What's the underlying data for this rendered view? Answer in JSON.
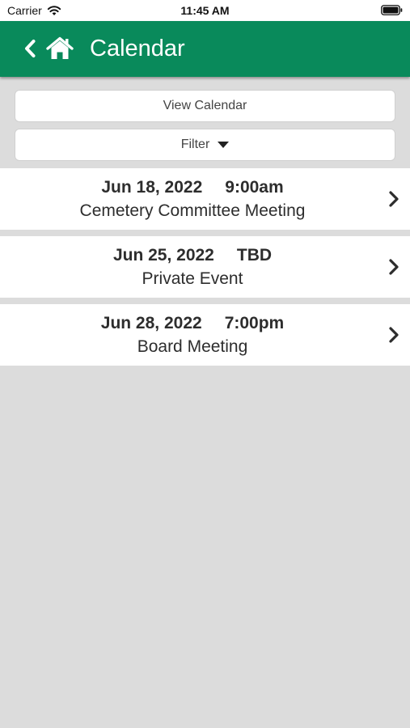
{
  "status_bar": {
    "carrier": "Carrier",
    "time": "11:45 AM"
  },
  "header": {
    "title": "Calendar",
    "back_icon": "chevron-left-icon",
    "home_icon": "home-icon"
  },
  "buttons": {
    "view_calendar": "View Calendar",
    "filter": "Filter"
  },
  "events": [
    {
      "date": "Jun 18, 2022",
      "time": "9:00am",
      "name": "Cemetery Committee Meeting"
    },
    {
      "date": "Jun 25, 2022",
      "time": "TBD",
      "name": "Private Event"
    },
    {
      "date": "Jun 28, 2022",
      "time": "7:00pm",
      "name": "Board Meeting"
    }
  ],
  "colors": {
    "header": "#098a5b",
    "background": "#dcdcdc"
  }
}
